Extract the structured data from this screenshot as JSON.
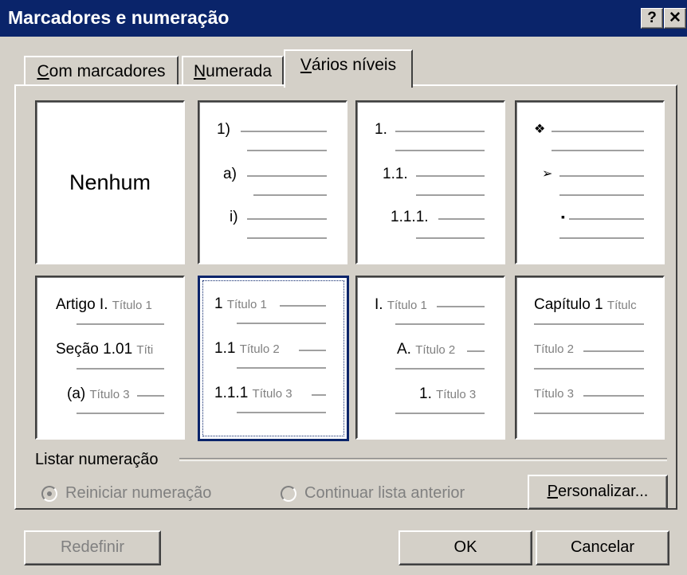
{
  "dialog": {
    "title": "Marcadores e numeração"
  },
  "titlebar": {
    "help_label": "?",
    "close_label": "✕"
  },
  "tabs": [
    {
      "label": "Com marcadores",
      "underline": "C",
      "rest": "om marcadores"
    },
    {
      "label": "Numerada",
      "underline": "N",
      "rest": "umerada"
    },
    {
      "label": "Vários níveis",
      "underline": "V",
      "rest": "ários níveis"
    }
  ],
  "gallery": {
    "none_label": "Nenhum",
    "outline2": [
      "1)",
      "a)",
      "i)"
    ],
    "outline3": [
      "1.",
      "1.1.",
      "1.1.1."
    ],
    "outline4_icons": [
      "diamond-bullet-icon",
      "arrow-bullet-icon",
      "square-bullet-icon"
    ],
    "outline5": [
      {
        "num": "Artigo I.",
        "text": "Título 1"
      },
      {
        "num": "Seção 1.01",
        "text": "Títi"
      },
      {
        "num": "(a)",
        "text": "Título 3"
      }
    ],
    "outline6": [
      {
        "num": "1",
        "text": "Título 1"
      },
      {
        "num": "1.1",
        "text": "Título 2"
      },
      {
        "num": "1.1.1",
        "text": "Título 3"
      }
    ],
    "outline7": [
      {
        "num": "I.",
        "text": "Título 1"
      },
      {
        "num": "A.",
        "text": "Título 2"
      },
      {
        "num": "1.",
        "text": "Título 3"
      }
    ],
    "outline8": [
      {
        "num": "Capítulo 1",
        "text": "Títulc"
      },
      {
        "num": "",
        "text": "Título 2"
      },
      {
        "num": "",
        "text": "Título 3"
      }
    ]
  },
  "list_numbering": {
    "label": "Listar numeração",
    "restart_label": "Reiniciar numeração",
    "continue_label": "Continuar lista anterior",
    "customize_underline": "P",
    "customize_rest": "ersonalizar..."
  },
  "buttons": {
    "reset": "Redefinir",
    "ok": "OK",
    "cancel": "Cancelar"
  }
}
